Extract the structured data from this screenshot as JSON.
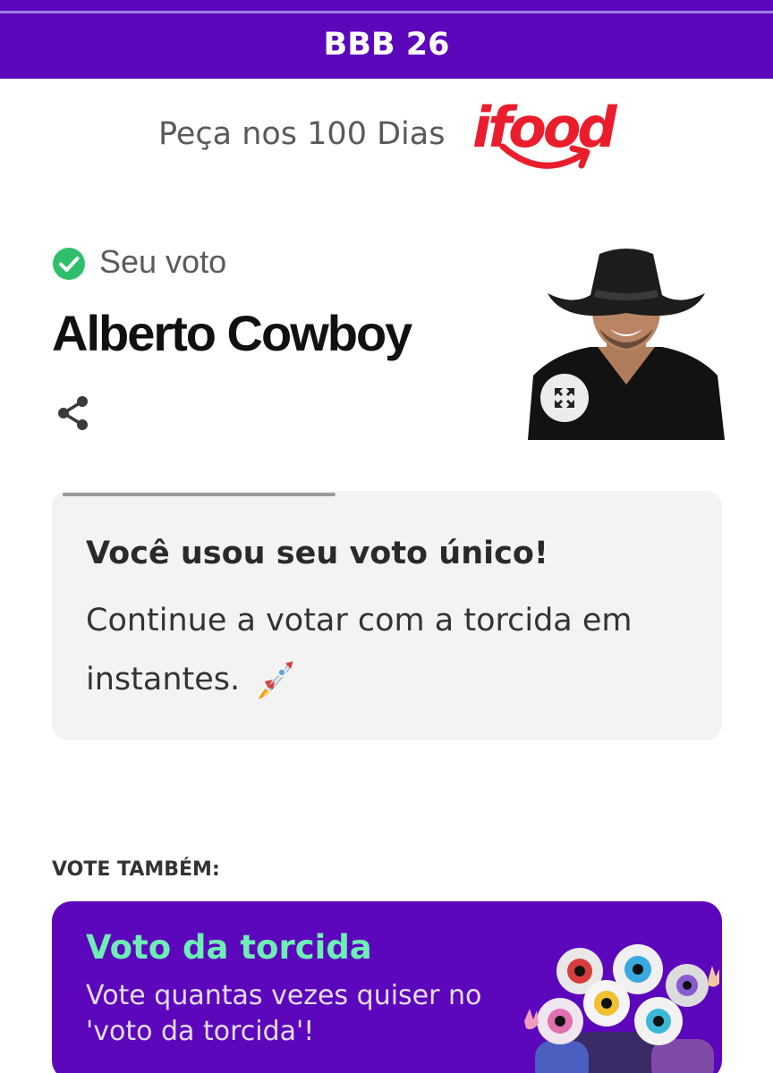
{
  "header": {
    "title": "BBB 26"
  },
  "sponsor": {
    "text": "Peça nos 100 Dias",
    "logo_text": "ifood"
  },
  "vote": {
    "label": "Seu voto",
    "candidate": "Alberto Cowboy"
  },
  "info_card": {
    "title": "Você usou seu voto único!",
    "message": "Continue a votar com a torcida em instantes."
  },
  "also_vote": {
    "label": "VOTE TAMBÉM:"
  },
  "crowd_vote": {
    "title": "Voto da torcida",
    "description": "Vote quantas vezes quiser no 'voto da torcida'!"
  },
  "icons": {
    "check": "check-circle-icon",
    "share": "share-icon",
    "expand": "expand-icon",
    "rocket": "rocket-emoji"
  },
  "colors": {
    "brand_purple": "#5c07bb",
    "check_green": "#2fbf6a",
    "crowd_title": "#6eeeb6",
    "ifood_red": "#ea1d2c"
  }
}
